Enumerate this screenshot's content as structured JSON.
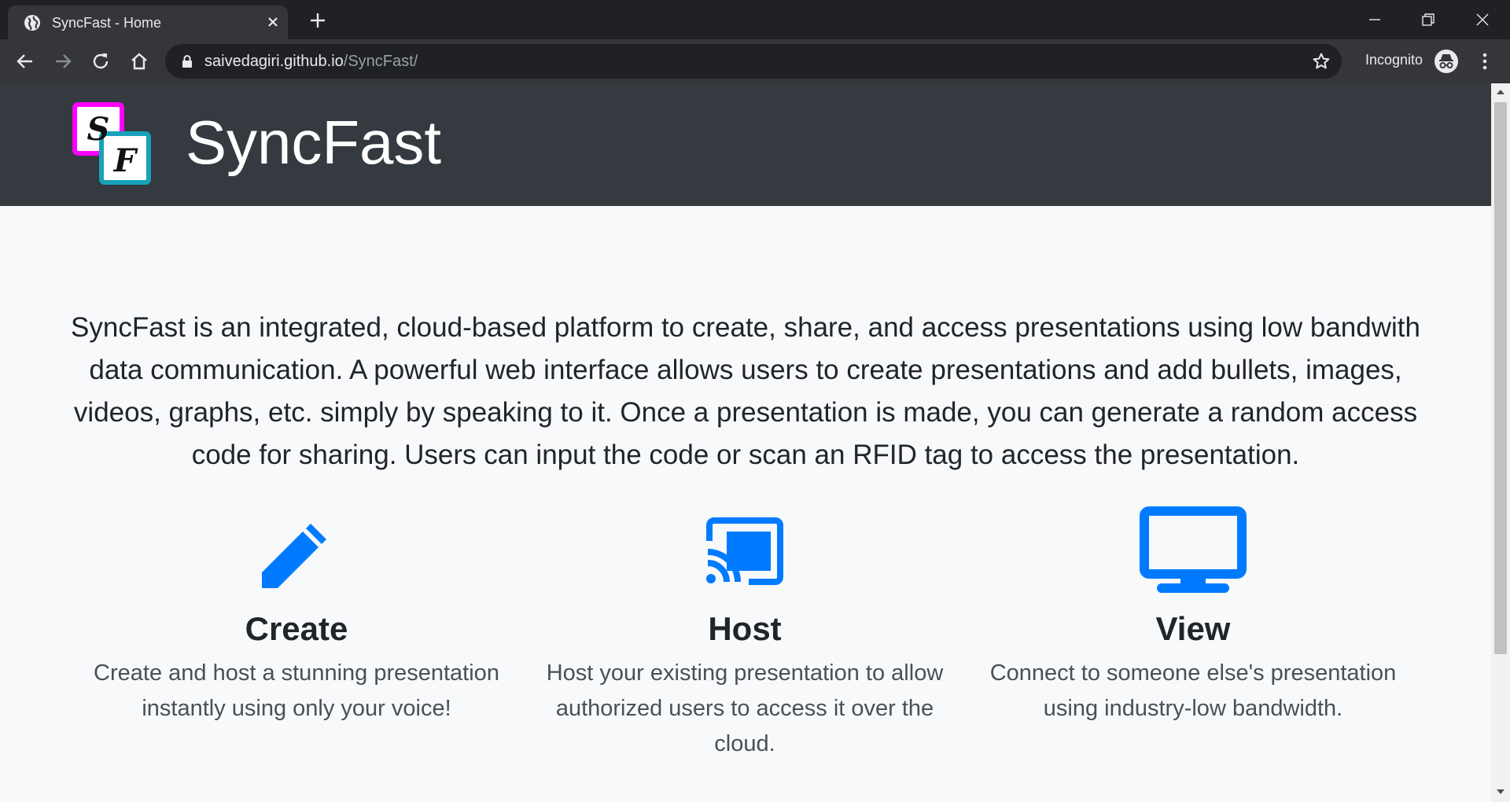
{
  "browser": {
    "tab_title": "SyncFast - Home",
    "url_host": "saivedagiri.github.io",
    "url_path": "/SyncFast/",
    "incognito_label": "Incognito"
  },
  "header": {
    "logo_letters": [
      "S",
      "F"
    ],
    "brand": "SyncFast"
  },
  "intro": {
    "text": "SyncFast is an integrated, cloud-based platform to create, share, and access presentations using low bandwith data communication. A powerful web interface allows users to create presentations and add bullets, images, videos, graphs, etc. simply by speaking to it. Once a presentation is made, you can generate a random access code for sharing. Users can input the code or scan an RFID tag to access the presentation."
  },
  "features": [
    {
      "icon": "pencil-icon",
      "title": "Create",
      "desc": "Create and host a stunning presentation instantly using only your voice!"
    },
    {
      "icon": "cast-icon",
      "title": "Host",
      "desc": "Host your existing presentation to allow authorized users to access it over the cloud."
    },
    {
      "icon": "monitor-icon",
      "title": "View",
      "desc": "Connect to someone else's presentation using industry-low bandwidth."
    }
  ],
  "colors": {
    "accent": "#007bff",
    "header_bg": "#343a40",
    "logo_magenta": "#ff00ff",
    "logo_cyan": "#17a2b8"
  }
}
